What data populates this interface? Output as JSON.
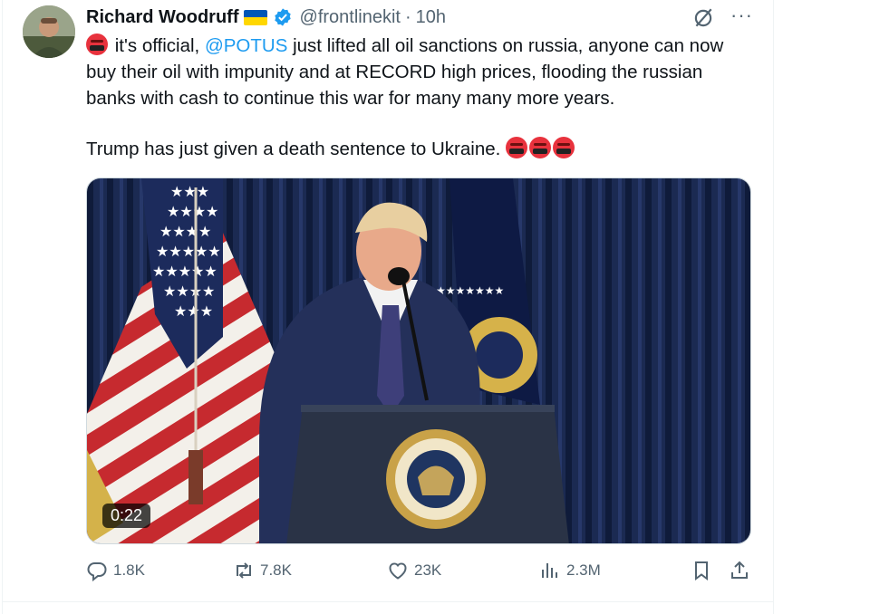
{
  "author": {
    "name": "Richard Woodruff",
    "handle": "@frontlinekit",
    "separator": "·",
    "time": "10h",
    "flag_colors": [
      "#0057b7",
      "#ffd700"
    ],
    "verified_color": "#1d9bf0"
  },
  "tweet": {
    "line1_a": "it's official,",
    "mention": "@POTUS",
    "line1_b": "just lifted all oil sanctions on russia, anyone can now buy their oil with impunity and at RECORD high prices, flooding the russian banks with cash to continue this war for many many more years.",
    "line2": "Trump has just given a death sentence to Ukraine."
  },
  "media": {
    "type": "video",
    "duration": "0:22"
  },
  "actions": {
    "replies": "1.8K",
    "reposts": "7.8K",
    "likes": "23K",
    "views": "2.3M"
  },
  "icons": [
    "grok-icon",
    "more-icon",
    "reply-icon",
    "repost-icon",
    "like-icon",
    "views-icon",
    "bookmark-icon",
    "share-icon",
    "angry-face-emoji"
  ],
  "colors": {
    "accent": "#1d9bf0",
    "muted": "#536471",
    "text": "#0f1419"
  }
}
